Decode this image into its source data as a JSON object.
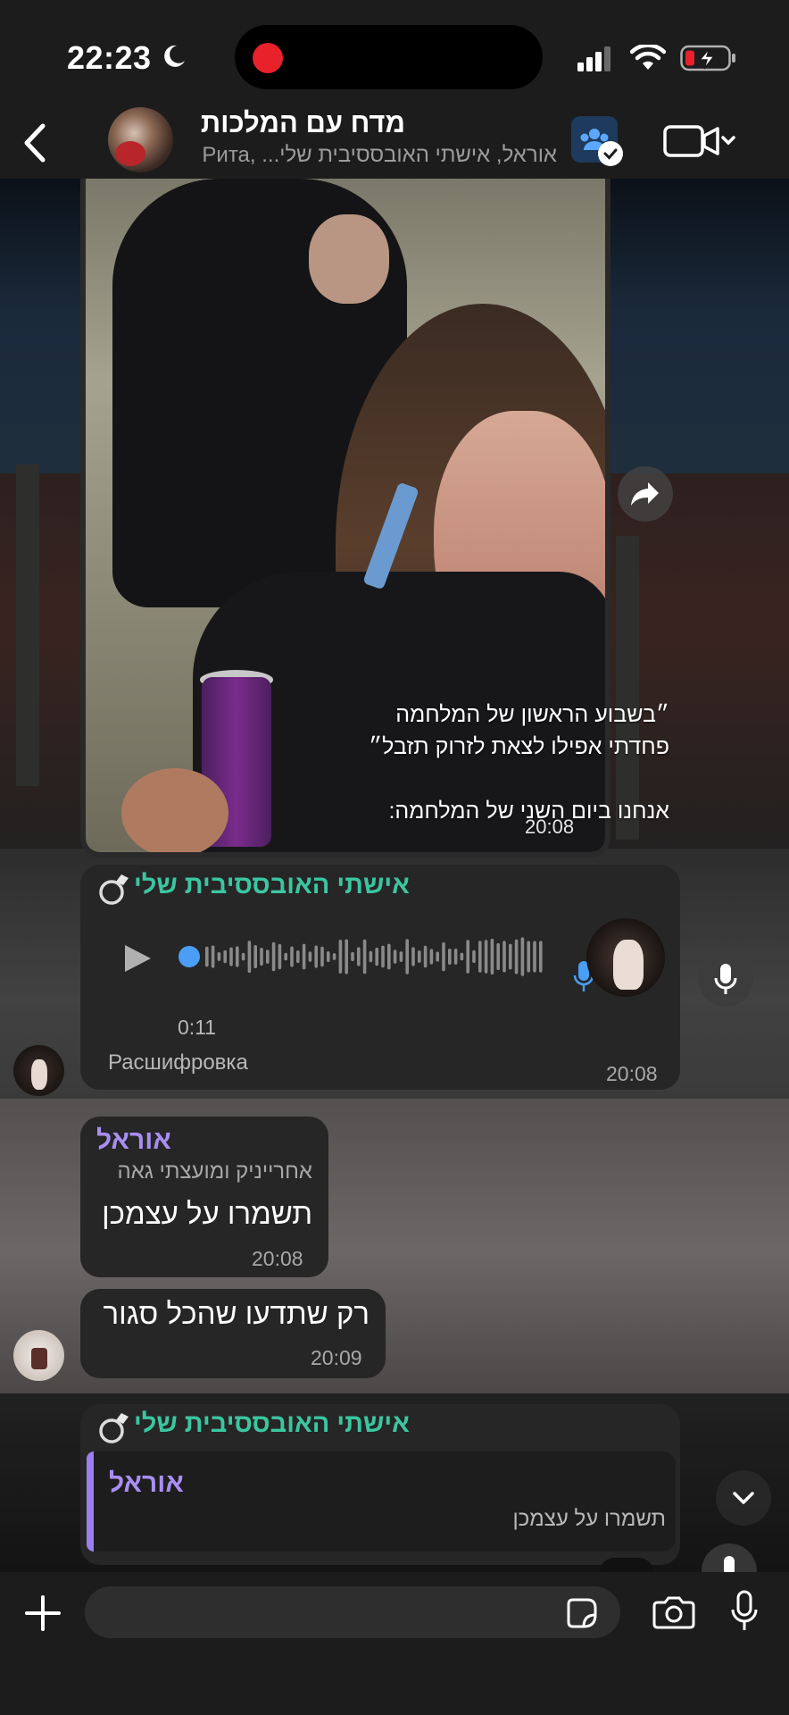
{
  "status_bar": {
    "time": "22:23",
    "icons": [
      "moon-icon",
      "screen-recording-indicator",
      "signal-icon",
      "wifi-icon",
      "battery-charging-icon"
    ]
  },
  "header": {
    "title": "מדח עם  המלכות",
    "subtitle": "אוראל, אישתי האובססיבית שלי... ,Рита",
    "icons": [
      "back-chevron-icon",
      "group-avatar",
      "members-check-icon",
      "video-call-icon",
      "chevron-down-icon"
    ]
  },
  "messages": {
    "media": {
      "caption_lines": [
        "״בשבוע הראשון של המלחמה",
        "פחדתי אפילו לצאת לזרוק תזבל״",
        "",
        "אנחנו ביום השני של המלחמה:"
      ],
      "time": "20:08",
      "share_icon": "share-arrow-icon"
    },
    "voice": {
      "sender": "אישתי האובססיבית שלי",
      "sender_icon": "ring-icon",
      "duration": "0:11",
      "transcribe_label": "Расшифровка",
      "time": "20:08"
    },
    "text1": {
      "sender": "אוראל",
      "role": "אחרייניק ומועצתי גאה",
      "text": "תשמרו על עצמכן",
      "time": "20:08"
    },
    "text2": {
      "text": "רק שתדעו שהכל סגור",
      "time": "20:09"
    },
    "reply": {
      "sender": "אישתי האובססיבית שלי",
      "sender_icon": "ring-icon",
      "quoted_sender": "אוראל",
      "quoted_text": "תשמרו על עצמכן"
    }
  },
  "input_bar": {
    "placeholder": "",
    "icons": [
      "plus-icon",
      "sticker-icon",
      "camera-icon",
      "microphone-icon"
    ]
  },
  "colors": {
    "accent_green": "#3bc6a0",
    "accent_purple": "#a98ef2",
    "recording_red": "#e8212b",
    "play_blue": "#4a9ef5",
    "bubble_bg": "#262626"
  }
}
